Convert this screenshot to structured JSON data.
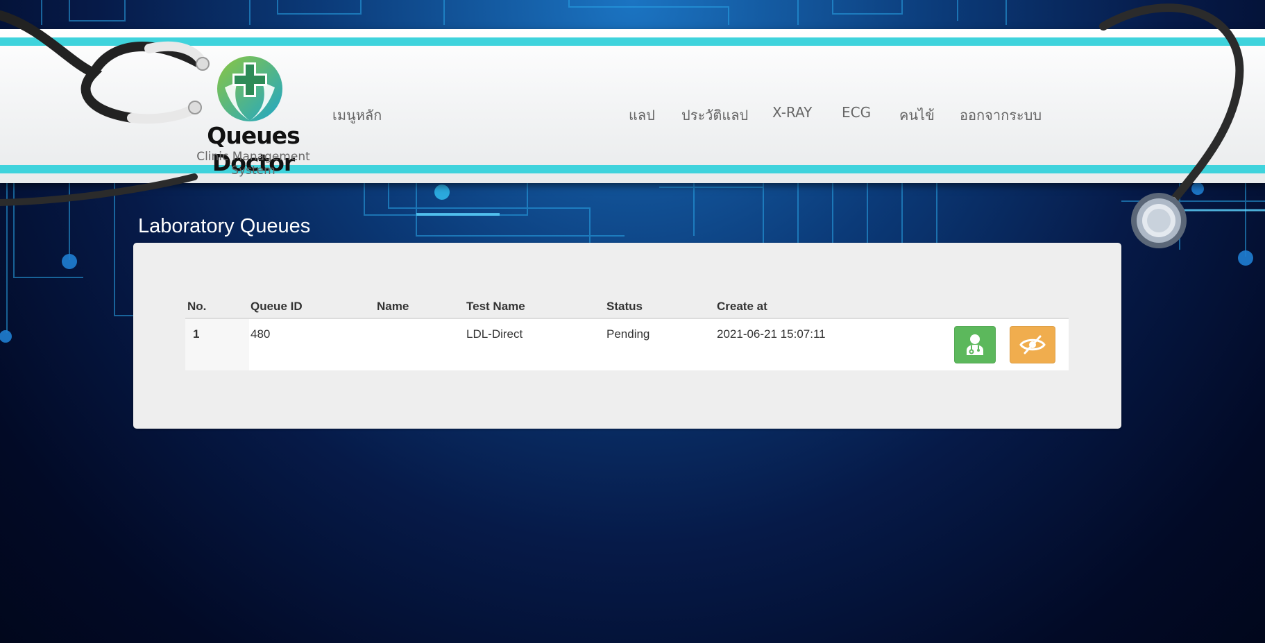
{
  "app": {
    "brand_title": "Queues Doctor",
    "brand_subtitle": "Clinic Management System"
  },
  "nav": {
    "home": "เมนูหลัก",
    "items": [
      {
        "label": "แลป"
      },
      {
        "label": "ประวัติแลป"
      },
      {
        "label": "X-RAY"
      },
      {
        "label": "ECG"
      },
      {
        "label": "คนไข้"
      },
      {
        "label": "ออกจากระบบ"
      }
    ]
  },
  "page": {
    "title": "Laboratory Queues"
  },
  "table": {
    "headers": [
      "No.",
      "Queue ID",
      "Name",
      "Test Name",
      "Status",
      "Create at"
    ],
    "rows": [
      {
        "no": "1",
        "queue_id": "480",
        "name": "",
        "test_name": "LDL-Direct",
        "status": "Pending",
        "created_at": "2021-06-21 15:07:11"
      }
    ]
  },
  "actions": {
    "doctor_icon": "doctor-icon",
    "hide_icon": "eye-slash-icon"
  },
  "colors": {
    "teal": "#3fd3dc",
    "success": "#5cb85c",
    "warning": "#f0ad4e",
    "panel": "#eeeeee"
  }
}
